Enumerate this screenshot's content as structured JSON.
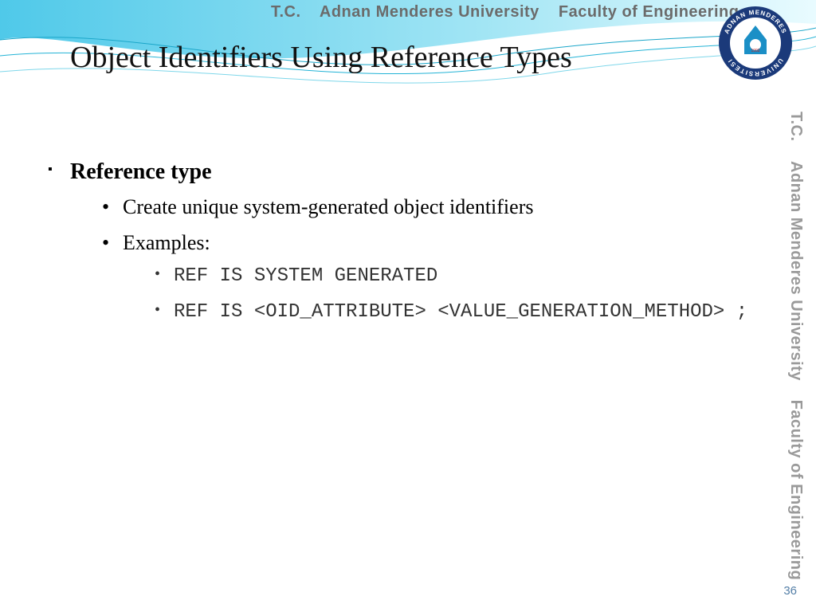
{
  "header": {
    "tc": "T.C.",
    "university": "Adnan Menderes University",
    "faculty": "Faculty of Engineering"
  },
  "logo": {
    "ring_top": "ADNAN MENDERES",
    "ring_bottom": "UNIVERSITESI",
    "year": "1992"
  },
  "title": "Object Identifiers Using Reference Types",
  "content": {
    "bullet1": "Reference type",
    "sub1": "Create unique system-generated object identifiers",
    "sub2": "Examples:",
    "example1": "REF IS SYSTEM GENERATED",
    "example2": "REF IS <OID_ATTRIBUTE> <VALUE_GENERATION_METHOD> ;"
  },
  "slide_number": "36"
}
